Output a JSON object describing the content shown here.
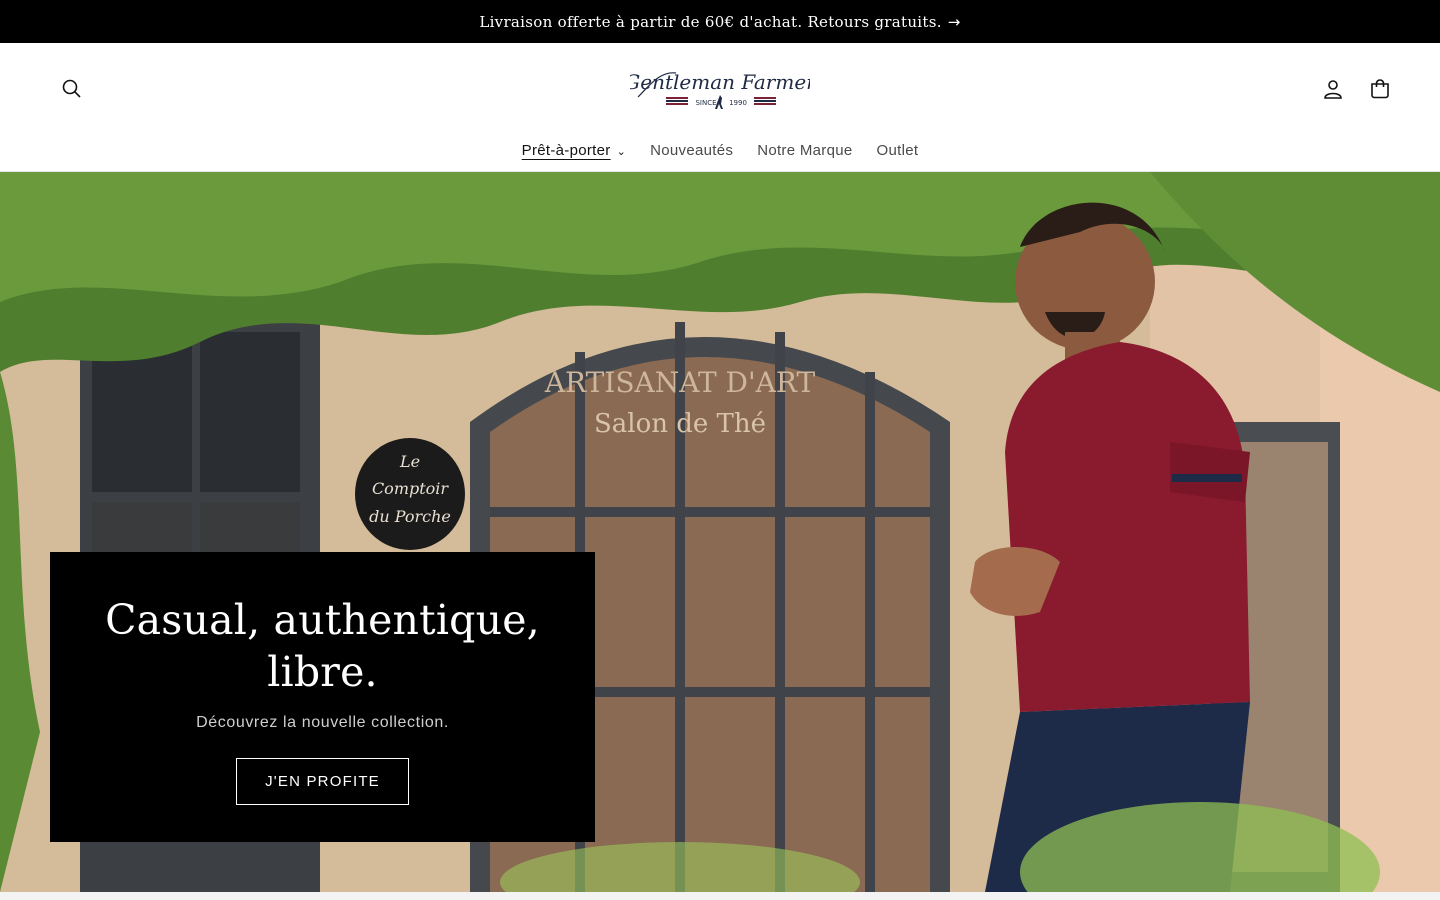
{
  "announcement": {
    "text": "Livraison offerte à partir de 60€ d'achat. Retours gratuits.",
    "arrow_icon": "arrow-right-icon"
  },
  "header": {
    "logo": {
      "script_text": "Gentleman Farmer",
      "since_text": "SINCE",
      "year_text": "1990"
    },
    "icons": [
      "search-icon",
      "account-icon",
      "cart-icon"
    ]
  },
  "nav": {
    "items": [
      {
        "label": "Prêt-à-porter",
        "has_dropdown": true,
        "active": true
      },
      {
        "label": "Nouveautés"
      },
      {
        "label": "Notre Marque"
      },
      {
        "label": "Outlet"
      }
    ]
  },
  "hero": {
    "title": "Casual, authentique, libre.",
    "subtitle": "Découvrez la nouvelle collection.",
    "cta_label": "J'EN PROFITE",
    "photo_signage": {
      "top": "ARTISANAT D'ART",
      "bottom": "Salon de Thé",
      "plaque_line1": "Le",
      "plaque_line2": "Comptoir",
      "plaque_line3": "du Porche"
    }
  },
  "colors": {
    "announcement_bg": "#000000",
    "header_bg": "#ffffff",
    "hero_box_bg": "#000000",
    "polo": "#8a1a2e",
    "trousers": "#1d2a48"
  }
}
